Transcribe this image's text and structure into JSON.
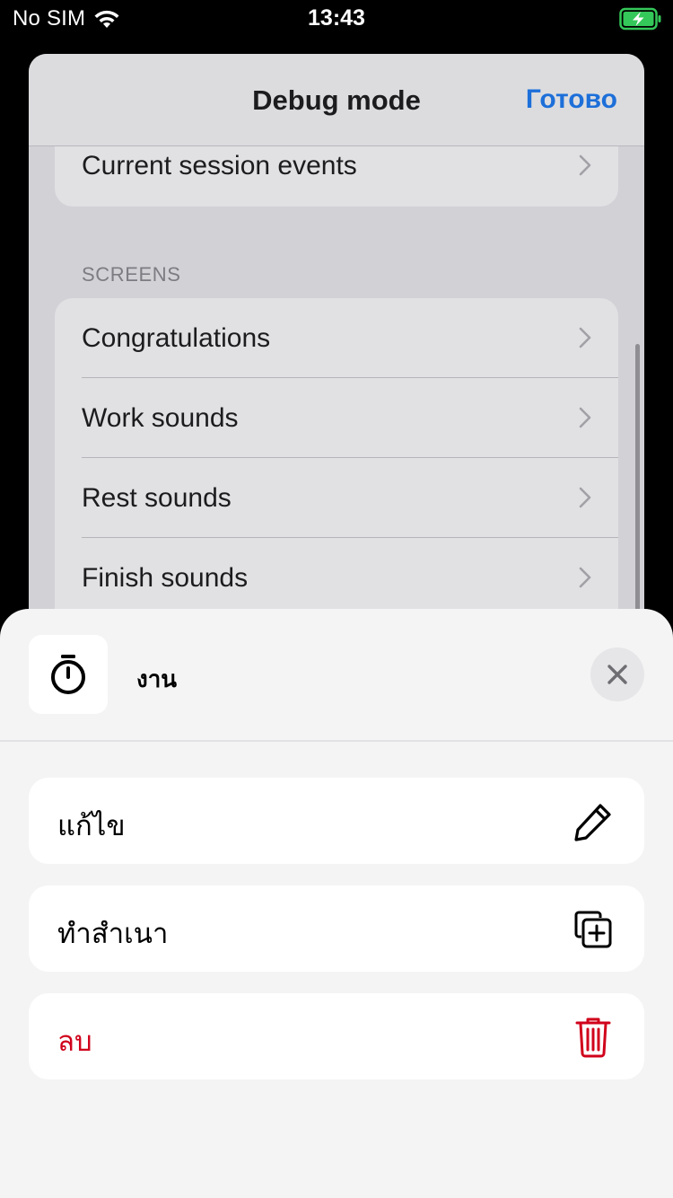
{
  "status_bar": {
    "carrier": "No SIM",
    "time": "13:43",
    "wifi_icon": "wifi-icon",
    "battery_icon": "battery-charging-icon",
    "battery_color": "#34c759"
  },
  "debug_sheet": {
    "title": "Debug mode",
    "done_label": "Готово",
    "accent_color": "#1d6fd9",
    "top_row": {
      "label": "Current session events"
    },
    "screens_section": {
      "header": "SCREENS",
      "items": [
        {
          "label": "Congratulations"
        },
        {
          "label": "Work sounds"
        },
        {
          "label": "Rest sounds"
        },
        {
          "label": "Finish sounds"
        }
      ]
    }
  },
  "action_sheet": {
    "icon": "stopwatch-icon",
    "title": "งาน",
    "close_icon": "close-icon",
    "actions": [
      {
        "label": "แก้ไข",
        "icon": "pencil-icon",
        "style": "default"
      },
      {
        "label": "ทำสำเนา",
        "icon": "duplicate-icon",
        "style": "default"
      },
      {
        "label": "ลบ",
        "icon": "trash-icon",
        "style": "destructive",
        "color": "#d0021b"
      }
    ]
  }
}
